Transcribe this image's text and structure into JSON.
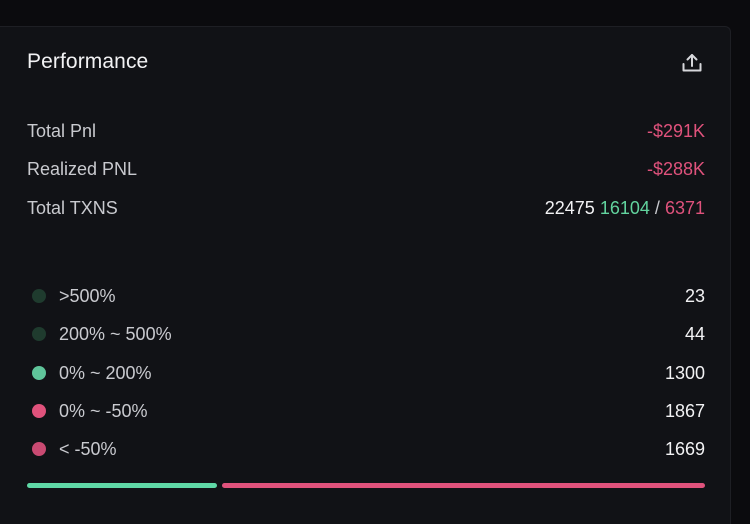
{
  "panel": {
    "title": "Performance",
    "share_icon": "share-export-icon"
  },
  "metrics": {
    "total_pnl": {
      "label": "Total Pnl",
      "value": "-$291K"
    },
    "realized_pnl": {
      "label": "Realized PNL",
      "value": "-$288K"
    },
    "total_txns": {
      "label": "Total TXNS",
      "total": "22475",
      "buys": "16104",
      "separator": "/",
      "sells": "6371"
    }
  },
  "distribution": [
    {
      "label": ">500%",
      "count": "23",
      "color": "#1f3b2e"
    },
    {
      "label": "200% ~ 500%",
      "count": "44",
      "color": "#1f3b2e"
    },
    {
      "label": "0% ~ 200%",
      "count": "1300",
      "color": "#5fc49a"
    },
    {
      "label": "0% ~ -50%",
      "count": "1867",
      "color": "#e0527c"
    },
    {
      "label": "< -50%",
      "count": "1669",
      "color": "#c94a72"
    }
  ],
  "ratio_bar": {
    "positive_fraction": 0.28,
    "positive_color": "#5fd8a6",
    "negative_color": "#e0527c"
  }
}
